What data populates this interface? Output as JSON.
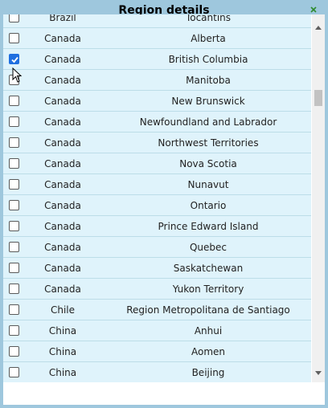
{
  "dialog": {
    "title": "Region details",
    "close_glyph": "x"
  },
  "rows": [
    {
      "country": "Brazil",
      "region": "Tocantins",
      "checked": false
    },
    {
      "country": "Canada",
      "region": "Alberta",
      "checked": false
    },
    {
      "country": "Canada",
      "region": "British Columbia",
      "checked": true
    },
    {
      "country": "Canada",
      "region": "Manitoba",
      "checked": false
    },
    {
      "country": "Canada",
      "region": "New Brunswick",
      "checked": false
    },
    {
      "country": "Canada",
      "region": "Newfoundland and Labrador",
      "checked": false
    },
    {
      "country": "Canada",
      "region": "Northwest Territories",
      "checked": false
    },
    {
      "country": "Canada",
      "region": "Nova Scotia",
      "checked": false
    },
    {
      "country": "Canada",
      "region": "Nunavut",
      "checked": false
    },
    {
      "country": "Canada",
      "region": "Ontario",
      "checked": false
    },
    {
      "country": "Canada",
      "region": "Prince Edward Island",
      "checked": false
    },
    {
      "country": "Canada",
      "region": "Quebec",
      "checked": false
    },
    {
      "country": "Canada",
      "region": "Saskatchewan",
      "checked": false
    },
    {
      "country": "Canada",
      "region": "Yukon Territory",
      "checked": false
    },
    {
      "country": "Chile",
      "region": "Region Metropolitana de Santiago",
      "checked": false
    },
    {
      "country": "China",
      "region": "Anhui",
      "checked": false
    },
    {
      "country": "China",
      "region": "Aomen",
      "checked": false
    },
    {
      "country": "China",
      "region": "Beijing",
      "checked": false
    }
  ],
  "colors": {
    "title_bar": "#9ec7dd",
    "row_background": "#dff3fb",
    "row_divider": "#bcdde8",
    "checkbox_checked": "#1f6fe0",
    "close_icon": "#2e8b2e"
  },
  "icons": {
    "close": "close-icon",
    "check": "checkmark-icon",
    "cursor": "mouse-pointer-icon"
  }
}
